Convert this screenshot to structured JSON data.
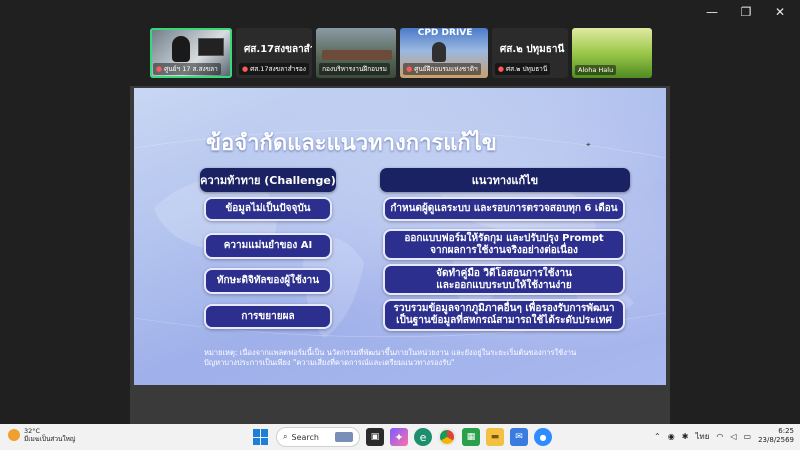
{
  "window_controls": {
    "minimize": "—",
    "restore": "❐",
    "close": "✕"
  },
  "participants": [
    {
      "caption": "ศูนย์ฯ 17 ส.สงขลา",
      "active": true
    },
    {
      "big_label": "ศส.17สงขลาสำรอง",
      "caption": "ศส.17สงขลาสำรอง"
    },
    {
      "caption": "กองบริหารงานฝึกอบรม"
    },
    {
      "caption": "ศูนย์ฝึกอบรมแห่งชาติฯ"
    },
    {
      "big_label": "ศส.๒ ปทุมธานี",
      "caption": "ศส.๒ ปทุมธานี"
    },
    {
      "caption": "Aloha Halu"
    }
  ],
  "tile_overlay": "CPD DRIVE",
  "slide": {
    "title": "ข้อจำกัดและแนวทางการแก้ไข",
    "challenge_header": "ความท้าทาย (Challenge)",
    "solution_header": "แนวทางแก้ไข",
    "challenges": [
      "ข้อมูลไม่เป็นปัจจุบัน",
      "ความแม่นยำของ AI",
      "ทักษะดิจิทัลของผู้ใช้งาน",
      "การขยายผล"
    ],
    "solutions": [
      {
        "line1": "กำหนดผู้ดูแลระบบ และรอบการตรวจสอบทุก 6 เดือน",
        "line2": ""
      },
      {
        "line1": "ออกแบบฟอร์มให้รัดกุม และปรับปรุง Prompt",
        "line2": "จากผลการใช้งานจริงอย่างต่อเนื่อง"
      },
      {
        "line1": "จัดทำคู่มือ วิดีโอสอนการใช้งาน",
        "line2": "และออกแบบระบบให้ใช้งานง่าย"
      },
      {
        "line1": "รวบรวมข้อมูลจากภูมิภาคอื่นๆ เพื่อรองรับการพัฒนา",
        "line2": "เป็นฐานข้อมูลที่สหกรณ์สามารถใช้ได้ระดับประเทศ"
      }
    ],
    "note_line1": "หมายเหตุ: เนื่องจากแพลตฟอร์มนี้เป็น นวัตกรรมที่พัฒนาขึ้นภายในหน่วยงาน และยังอยู่ในระยะเริ่มต้นของการใช้งาน",
    "note_line2": "ปัญหาบางประการเป็นเพียง \"ความเสี่ยงที่คาดการณ์และเตรียมแนวทางรองรับ\""
  },
  "taskbar": {
    "temperature": "32°C",
    "weather": "มีเมฆเป็นส่วนใหญ่",
    "search_placeholder": "Search",
    "language": "ไทย",
    "time": "6:25",
    "date": "23/8/2569"
  }
}
